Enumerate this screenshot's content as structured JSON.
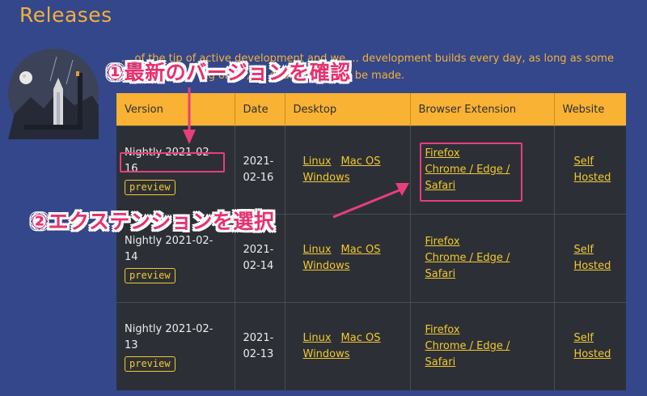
{
  "page": {
    "title": "Releases",
    "intro_line1": "... of the tip of active development and we ... development builds every day, as long as some",
    "intro_line2": "... e try ... y ... ing order, no guarantees can be made."
  },
  "table": {
    "headers": [
      "Version",
      "Date",
      "Desktop",
      "Browser Extension",
      "Website"
    ],
    "rows": [
      {
        "version": "Nightly 2021-02-16",
        "badge": "preview",
        "date_l1": "2021-",
        "date_l2": "02-16",
        "linux": "Linux",
        "macos": "Mac OS",
        "windows": "Windows",
        "firefox": "Firefox",
        "chrome": "Chrome / Edge /",
        "safari": "Safari",
        "self": "Self",
        "hosted": "Hosted"
      },
      {
        "version": "Nightly 2021-02-14",
        "badge": "preview",
        "date_l1": "2021-",
        "date_l2": "02-14",
        "linux": "Linux",
        "macos": "Mac OS",
        "windows": "Windows",
        "firefox": "Firefox",
        "chrome": "Chrome / Edge /",
        "safari": "Safari",
        "self": "Self",
        "hosted": "Hosted"
      },
      {
        "version": "Nightly 2021-02-13",
        "badge": "preview",
        "date_l1": "2021-",
        "date_l2": "02-13",
        "linux": "Linux",
        "macos": "Mac OS",
        "windows": "Windows",
        "firefox": "Firefox",
        "chrome": "Chrome / Edge /",
        "safari": "Safari",
        "self": "Self",
        "hosted": "Hosted"
      }
    ]
  },
  "annotations": {
    "step1": "①最新のバージョンを確認",
    "step2": "②エクステンションを選択"
  },
  "colors": {
    "background": "#34478a",
    "accent": "#f9b233",
    "link": "#f3c82f",
    "annotation": "#e8306f"
  }
}
